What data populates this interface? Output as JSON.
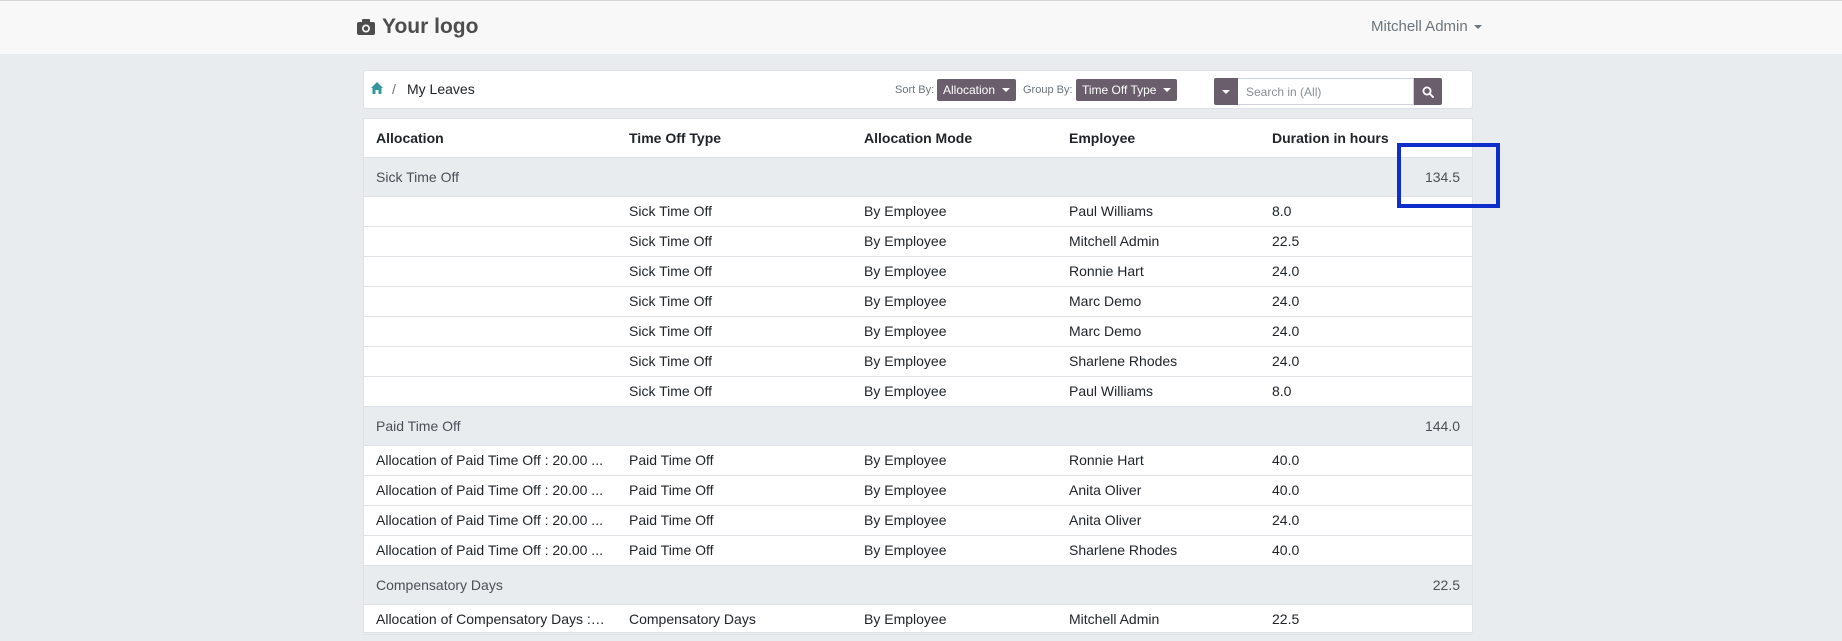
{
  "header": {
    "logo_text": "Your logo",
    "user_name": "Mitchell Admin"
  },
  "breadcrumb": {
    "separator": "/",
    "current": "My Leaves"
  },
  "controls": {
    "sort_label": "Sort By:",
    "sort_value": "Allocation",
    "group_label": "Group By:",
    "group_value": "Time Off Type",
    "search_placeholder": "Search in (All)"
  },
  "table": {
    "columns": [
      "Allocation",
      "Time Off Type",
      "Allocation Mode",
      "Employee",
      "Duration in hours"
    ],
    "groups": [
      {
        "name": "Sick Time Off",
        "total": "134.5",
        "rows": [
          {
            "allocation": "",
            "type": "Sick Time Off",
            "mode": "By Employee",
            "employee": "Paul Williams",
            "duration": "8.0"
          },
          {
            "allocation": "",
            "type": "Sick Time Off",
            "mode": "By Employee",
            "employee": "Mitchell Admin",
            "duration": "22.5"
          },
          {
            "allocation": "",
            "type": "Sick Time Off",
            "mode": "By Employee",
            "employee": "Ronnie Hart",
            "duration": "24.0"
          },
          {
            "allocation": "",
            "type": "Sick Time Off",
            "mode": "By Employee",
            "employee": "Marc Demo",
            "duration": "24.0"
          },
          {
            "allocation": "",
            "type": "Sick Time Off",
            "mode": "By Employee",
            "employee": "Marc Demo",
            "duration": "24.0"
          },
          {
            "allocation": "",
            "type": "Sick Time Off",
            "mode": "By Employee",
            "employee": "Sharlene Rhodes",
            "duration": "24.0"
          },
          {
            "allocation": "",
            "type": "Sick Time Off",
            "mode": "By Employee",
            "employee": "Paul Williams",
            "duration": "8.0"
          }
        ]
      },
      {
        "name": "Paid Time Off",
        "total": "144.0",
        "rows": [
          {
            "allocation": "Allocation of Paid Time Off : 20.00 ...",
            "type": "Paid Time Off",
            "mode": "By Employee",
            "employee": "Ronnie Hart",
            "duration": "40.0"
          },
          {
            "allocation": "Allocation of Paid Time Off : 20.00 ...",
            "type": "Paid Time Off",
            "mode": "By Employee",
            "employee": "Anita Oliver",
            "duration": "40.0"
          },
          {
            "allocation": "Allocation of Paid Time Off : 20.00 ...",
            "type": "Paid Time Off",
            "mode": "By Employee",
            "employee": "Anita Oliver",
            "duration": "24.0"
          },
          {
            "allocation": "Allocation of Paid Time Off : 20.00 ...",
            "type": "Paid Time Off",
            "mode": "By Employee",
            "employee": "Sharlene Rhodes",
            "duration": "40.0"
          }
        ]
      },
      {
        "name": "Compensatory Days",
        "total": "22.5",
        "rows": [
          {
            "allocation": "Allocation of Compensatory Days : ...",
            "type": "Compensatory Days",
            "mode": "By Employee",
            "employee": "Mitchell Admin",
            "duration": "22.5"
          }
        ]
      }
    ]
  },
  "colors": {
    "accent": "#6b5e6c",
    "highlight": "#0d2ecb",
    "home_icon": "#35979c"
  },
  "icons": {
    "logo": "camera-icon",
    "home": "home-icon",
    "search": "search-icon"
  }
}
